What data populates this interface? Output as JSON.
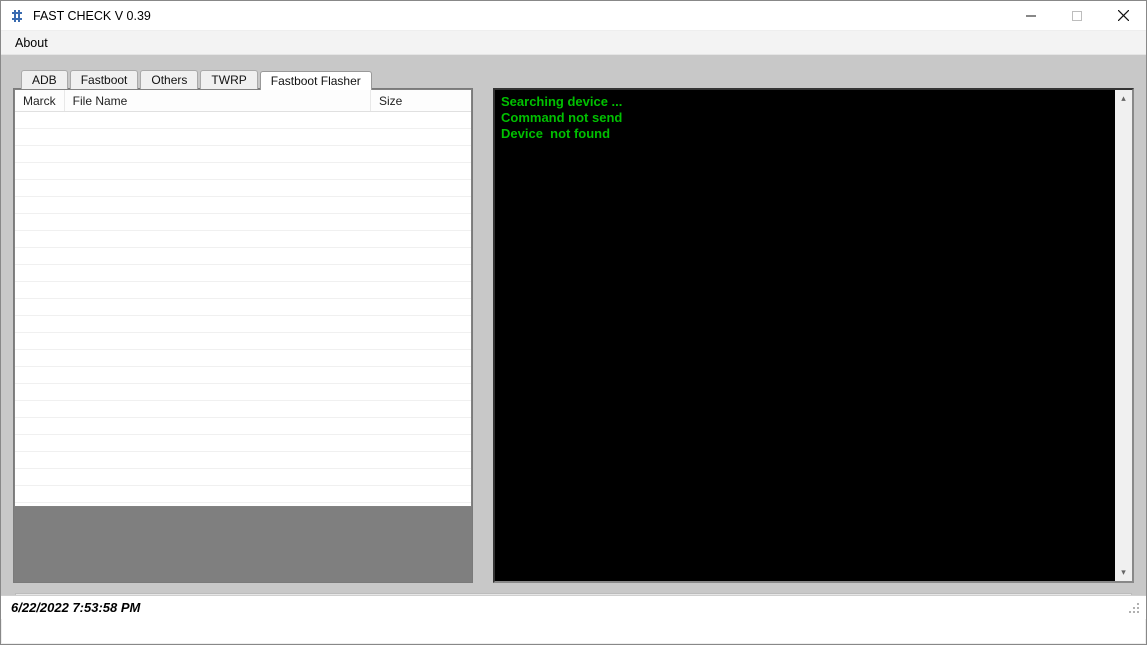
{
  "window": {
    "title": "FAST CHECK     V 0.39"
  },
  "menu": {
    "about": "About"
  },
  "tabs": [
    {
      "label": "ADB",
      "active": false
    },
    {
      "label": "Fastboot",
      "active": false
    },
    {
      "label": "Others",
      "active": false
    },
    {
      "label": "TWRP",
      "active": false
    },
    {
      "label": "Fastboot Flasher",
      "active": true
    }
  ],
  "list": {
    "columns": {
      "marck": "Marck",
      "filename": "File Name",
      "size": "Size"
    },
    "rows": []
  },
  "console": {
    "lines": [
      "Searching device ...",
      "Command not send",
      "Device  not found"
    ]
  },
  "status": {
    "datetime": "6/22/2022 7:53:58 PM"
  },
  "colors": {
    "console_bg": "#000000",
    "console_fg": "#00c000",
    "client_bg": "#c8c8c8"
  }
}
